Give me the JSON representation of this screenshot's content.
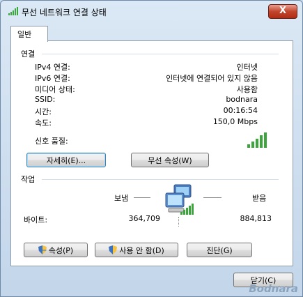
{
  "window": {
    "title": "무선 네트워크 연결 상태",
    "close_label": "X"
  },
  "tabs": [
    {
      "label": "일반"
    }
  ],
  "connection": {
    "group_label": "연결",
    "rows": [
      {
        "label": "IPv4 연결:",
        "value": "인터넷"
      },
      {
        "label": "IPv6 연결:",
        "value": "인터넷에 연결되어 있지 않음"
      },
      {
        "label": "미디어 상태:",
        "value": "사용함"
      },
      {
        "label": "SSID:",
        "value": "bodnara"
      },
      {
        "label": "시간:",
        "value": "00:16:54"
      },
      {
        "label": "속도:",
        "value": "150,0 Mbps"
      }
    ],
    "signal_label": "신호 품질:",
    "signal_bars": 5,
    "details_button": "자세히(E)...",
    "wireless_props_button": "무선 속성(W)"
  },
  "activity": {
    "group_label": "작업",
    "sent_label": "보냄",
    "received_label": "받음",
    "bytes_label": "바이트:",
    "bytes_sent": "364,709",
    "bytes_received": "884,813"
  },
  "buttons": {
    "properties": "속성(P)",
    "disable": "사용 안 함(D)",
    "diagnose": "진단(G)",
    "close": "닫기(C)"
  },
  "watermark": "Bodnara",
  "colors": {
    "signal": "#3ca53c",
    "titlebar": "#c9dcee",
    "close": "#c2452c"
  }
}
